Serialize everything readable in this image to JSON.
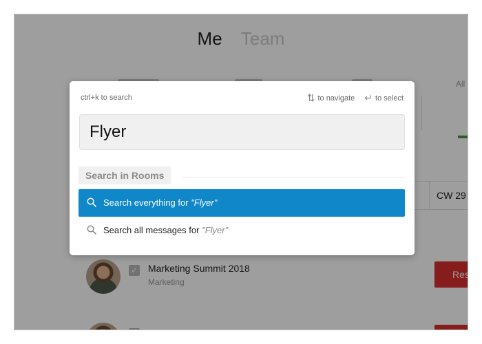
{
  "background": {
    "tabs": [
      {
        "label": "Me",
        "active": true
      },
      {
        "label": "Team",
        "active": false
      }
    ],
    "filter_label": "All",
    "week_label": "CW 29",
    "rooms": [
      {
        "title": "Marketing Summit 2018",
        "subtitle": "Marketing",
        "action_label": "Res"
      },
      {
        "title": "",
        "subtitle": "",
        "action_label": ""
      }
    ]
  },
  "search_modal": {
    "hint_left": "ctrl+k to search",
    "hint_navigate": "to navigate",
    "hint_select": "to select",
    "query": "Flyer",
    "section_label": "Search in Rooms",
    "options": [
      {
        "prefix": "Search everything for ",
        "term": "\"Flyer\"",
        "highlighted": true
      },
      {
        "prefix": "Search all messages for ",
        "term": "\"Flyer\"",
        "highlighted": false
      }
    ]
  },
  "colors": {
    "highlight": "#0f87c8",
    "danger": "#d9302e",
    "overlay": "rgba(0,0,0,0.38)"
  },
  "icons": {
    "navigate": "up-down-arrows-icon",
    "select": "return-key-icon",
    "search": "search-icon"
  }
}
